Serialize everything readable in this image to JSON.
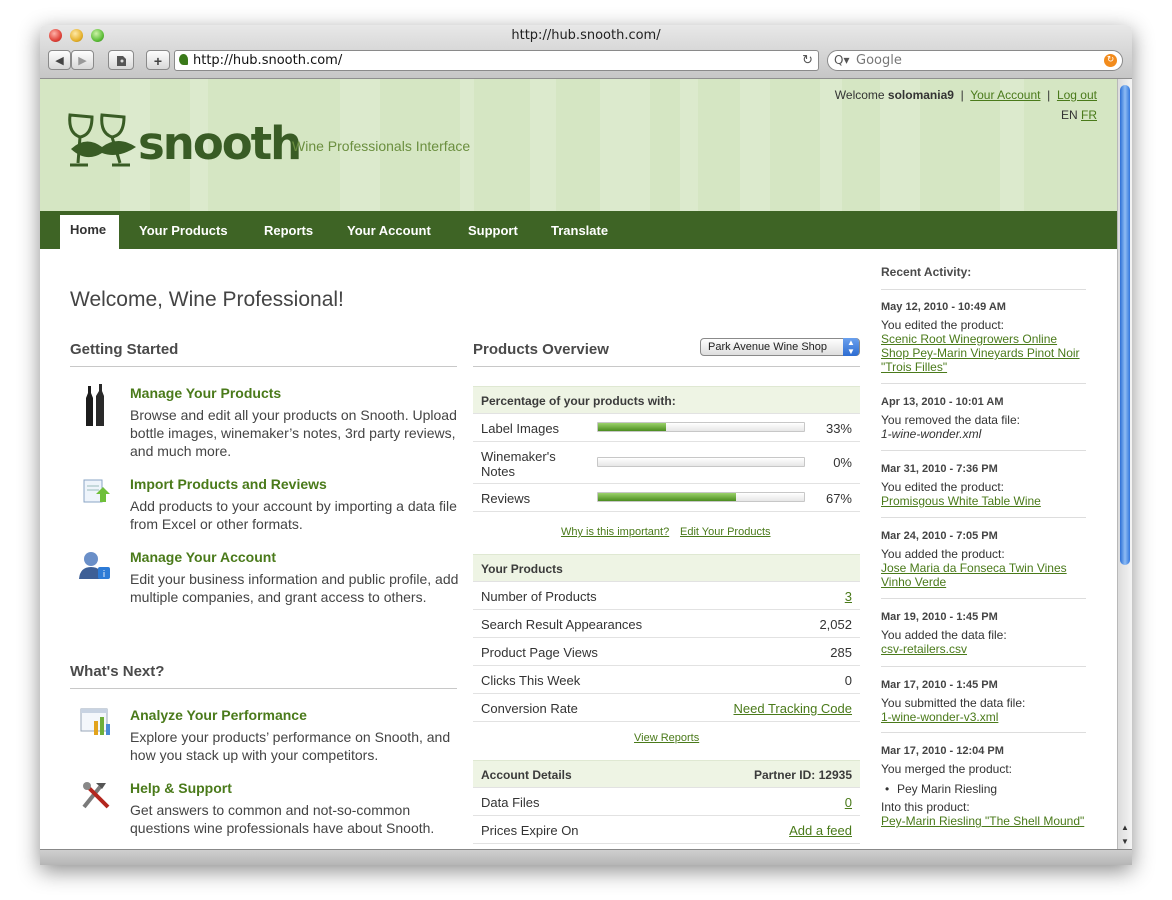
{
  "browser": {
    "title": "http://hub.snooth.com/",
    "url": "http://hub.snooth.com/",
    "search_placeholder": "Google",
    "nav_back": "◀",
    "nav_forward": "▶",
    "add_label": "+",
    "reload": "↻",
    "search_glyph": "Q▾",
    "search_badge": "↻"
  },
  "header": {
    "logo": "snooth",
    "tagline": "Wine Professionals Interface",
    "welcome_prefix": "Welcome ",
    "username": "solomania9",
    "divider": "|",
    "your_account": "Your Account",
    "logout": "Log out",
    "lang_current": "EN",
    "lang_alt": "FR"
  },
  "nav": [
    "Home",
    "Your Products",
    "Reports",
    "Your Account",
    "Support",
    "Translate"
  ],
  "main": {
    "heading": "Welcome, Wine Professional!",
    "getting_started": "Getting Started",
    "whats_next": "What's Next?",
    "items": [
      {
        "title": "Manage Your Products",
        "desc": "Browse and edit all your products on Snooth. Upload bottle images, winemaker’s notes, 3rd party reviews, and much more."
      },
      {
        "title": "Import Products and Reviews",
        "desc": "Add products to your account by importing a data file from Excel or other formats."
      },
      {
        "title": "Manage Your Account",
        "desc": "Edit your business information and public profile, add multiple companies, and grant access to others."
      },
      {
        "title": "Analyze Your Performance",
        "desc": "Explore your products’ performance on Snooth, and how you stack up with your competitors."
      },
      {
        "title": "Help & Support",
        "desc": "Get answers to common and not-so-common questions wine professionals have about Snooth."
      }
    ]
  },
  "overview": {
    "title": "Products Overview",
    "shop_select": "Park Avenue Wine Shop",
    "select_caret_up": "▲",
    "select_caret_down": "▼",
    "pct_header": "Percentage of your products with:",
    "pct_rows": [
      {
        "label": "Label Images",
        "value": "33%",
        "pct": 33
      },
      {
        "label": "Winemaker's Notes",
        "value": "0%",
        "pct": 0
      },
      {
        "label": "Reviews",
        "value": "67%",
        "pct": 67
      }
    ],
    "why_link": "Why is this important?",
    "edit_link": "Edit Your Products",
    "products_header": "Your Products",
    "products_rows": [
      {
        "label": "Number of Products",
        "value": "3"
      },
      {
        "label": "Search Result Appearances",
        "value": "2,052"
      },
      {
        "label": "Product Page Views",
        "value": "285"
      },
      {
        "label": "Clicks This Week",
        "value": "0"
      },
      {
        "label": "Conversion Rate",
        "value": "Need Tracking Code"
      }
    ],
    "view_reports": "View Reports",
    "account_header": "Account Details",
    "partner_id": "Partner ID: 12935",
    "account_rows": [
      {
        "label": "Data Files",
        "value": "0"
      },
      {
        "label": "Prices Expire On",
        "value": "Add a feed"
      }
    ]
  },
  "activity": {
    "title": "Recent Activity:",
    "entries": [
      {
        "date": "May 12, 2010 - 10:49 AM",
        "text": "You edited the product:",
        "link": "Scenic Root Winegrowers Online Shop Pey-Marin Vineyards Pinot Noir \"Trois Filles\""
      },
      {
        "date": "Apr 13, 2010 - 10:01 AM",
        "text": "You removed the data file:",
        "italic": "1-wine-wonder.xml"
      },
      {
        "date": "Mar 31, 2010 - 7:36 PM",
        "text": "You edited the product:",
        "link": "Promisgous White Table Wine"
      },
      {
        "date": "Mar 24, 2010 - 7:05 PM",
        "text": "You added the product:",
        "link": "Jose Maria da Fonseca Twin Vines Vinho Verde"
      },
      {
        "date": "Mar 19, 2010 - 1:45 PM",
        "text": "You added the data file:",
        "link": "csv-retailers.csv"
      },
      {
        "date": "Mar 17, 2010 - 1:45 PM",
        "text": "You submitted the data file:",
        "link": "1-wine-wonder-v3.xml"
      },
      {
        "date": "Mar 17, 2010 - 12:04 PM",
        "text": "You merged the product:",
        "bullet": "Pey Marin Riesling",
        "text2": "Into this product:",
        "link": "Pey-Marin Riesling \"The Shell Mound\""
      }
    ]
  }
}
